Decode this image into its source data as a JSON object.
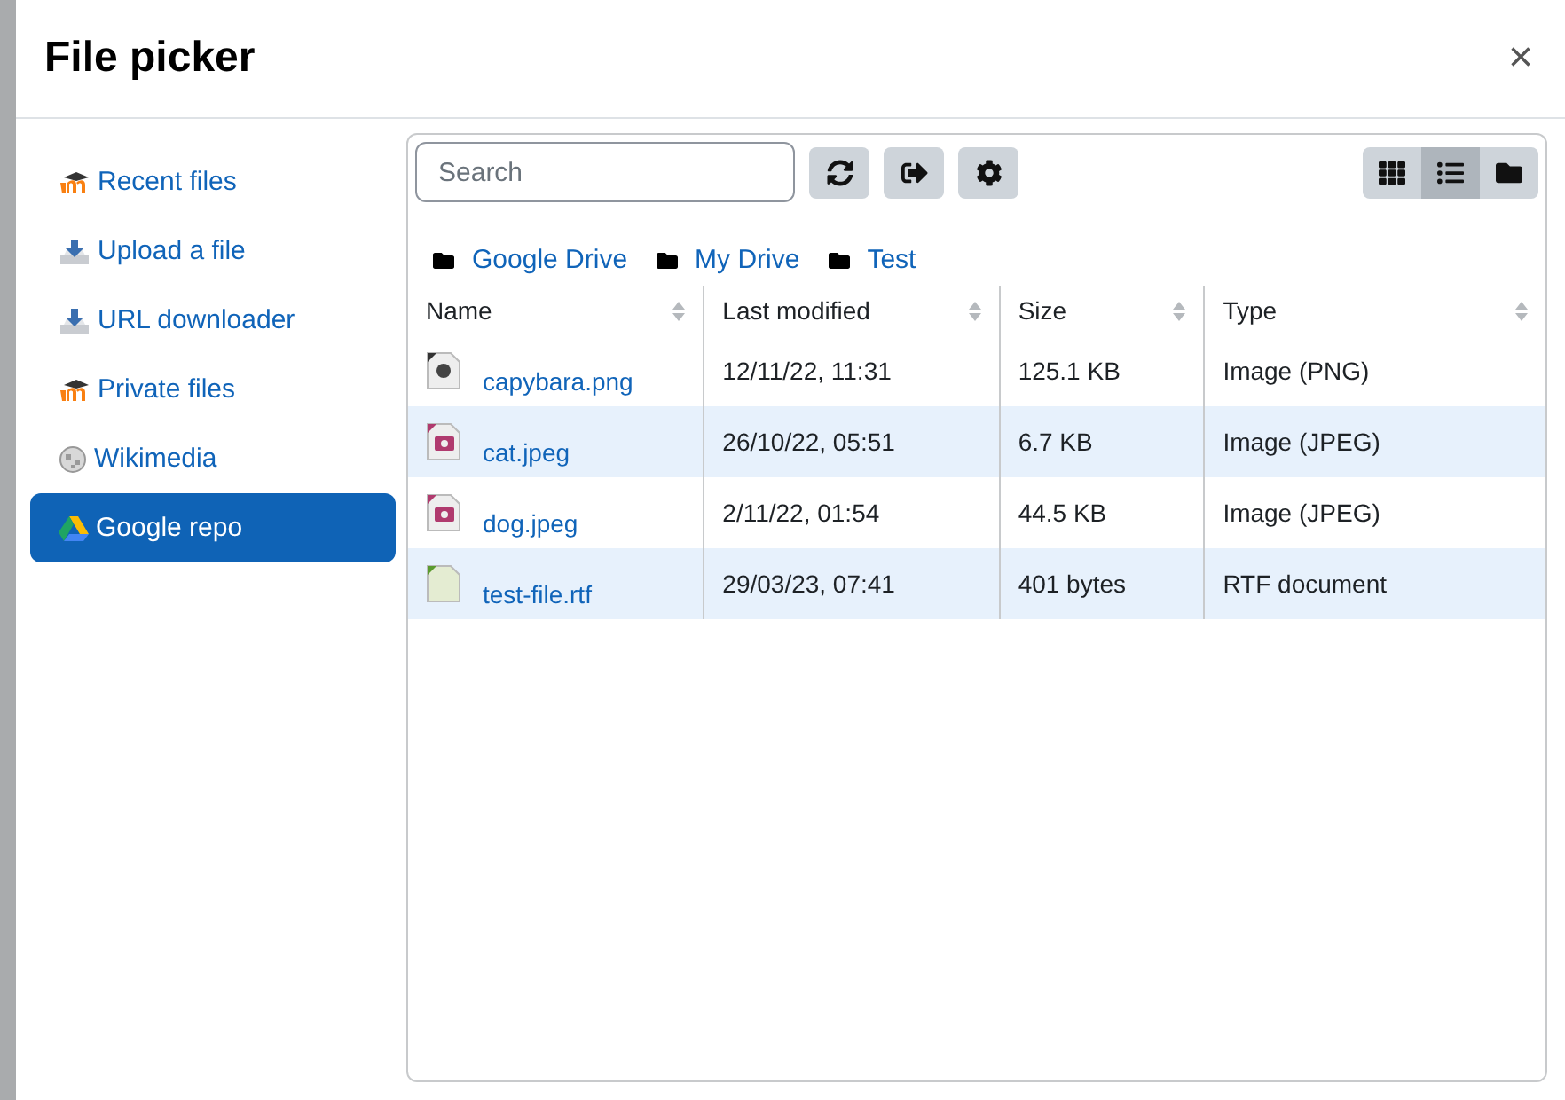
{
  "dialog": {
    "title": "File picker",
    "close": "×"
  },
  "sidebar": {
    "items": [
      {
        "label": "Recent files",
        "kind": "moodle",
        "selected": false
      },
      {
        "label": "Upload a file",
        "kind": "upload",
        "selected": false
      },
      {
        "label": "URL downloader",
        "kind": "upload",
        "selected": false
      },
      {
        "label": "Private files",
        "kind": "moodle",
        "selected": false
      },
      {
        "label": "Wikimedia",
        "kind": "globe",
        "selected": false
      },
      {
        "label": "Google repo",
        "kind": "drive",
        "selected": true
      }
    ]
  },
  "toolbar": {
    "search": {
      "placeholder": "Search"
    },
    "views": [
      {
        "kind": "grid",
        "selected": false
      },
      {
        "kind": "list",
        "selected": true
      },
      {
        "kind": "tree",
        "selected": false
      }
    ]
  },
  "breadcrumb": [
    "Google Drive",
    "My Drive",
    "Test"
  ],
  "table": {
    "columns": [
      "Name",
      "Last modified",
      "Size",
      "Type"
    ],
    "rows": [
      {
        "kind": "image",
        "name": "capybara.png",
        "modified": "12/11/22, 11:31",
        "size": "125.1 KB",
        "type": "Image (PNG)"
      },
      {
        "kind": "photo",
        "name": "cat.jpeg",
        "modified": "26/10/22, 05:51",
        "size": "6.7 KB",
        "type": "Image (JPEG)"
      },
      {
        "kind": "photo",
        "name": "dog.jpeg",
        "modified": "2/11/22, 01:54",
        "size": "44.5 KB",
        "type": "Image (JPEG)"
      },
      {
        "kind": "document",
        "name": "test-file.rtf",
        "modified": "29/03/23, 07:41",
        "size": "401 bytes",
        "type": "RTF document"
      }
    ]
  }
}
